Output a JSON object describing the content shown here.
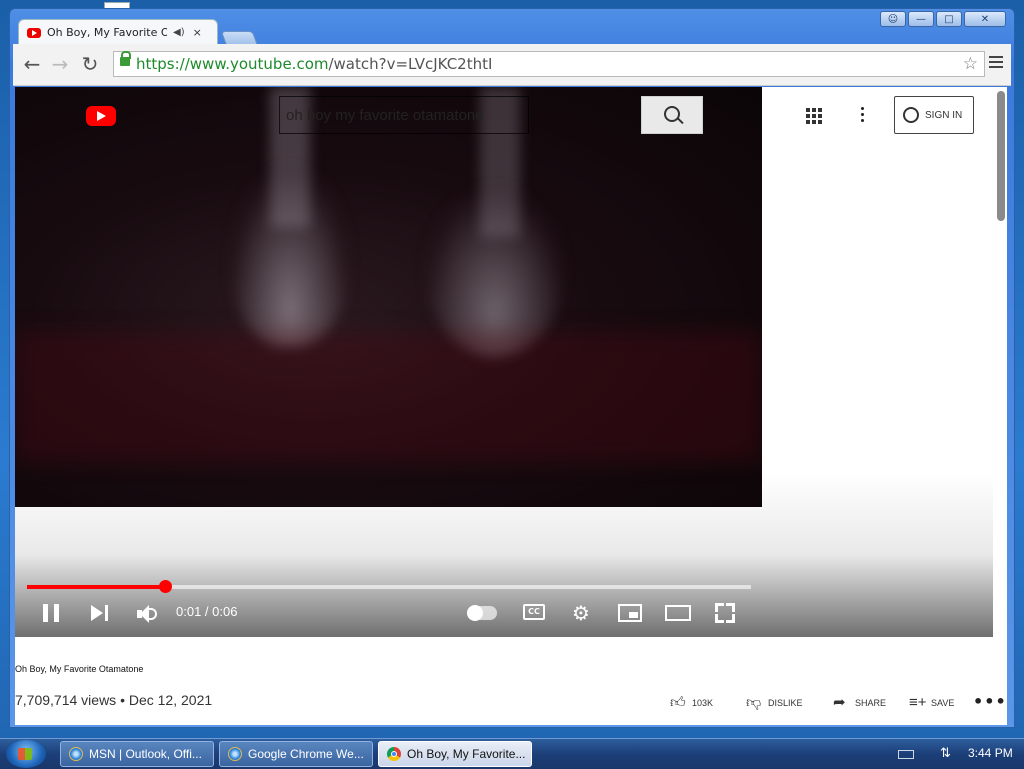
{
  "browser": {
    "tab_title": "Oh Boy, My Favorite Ot",
    "tab_audio_icon": "speaker-icon",
    "tab_close": "×",
    "url_scheme": "https://",
    "url_host": "www.youtube.com",
    "url_path": "/watch?v=LVcJKC2thtI",
    "window_controls": [
      "user-icon",
      "minimize-icon",
      "maximize-icon",
      "close-icon"
    ]
  },
  "youtube": {
    "search_value": "oh boy my favorite otamatone",
    "signin_label": "SIGN IN",
    "video": {
      "time": "0:01 / 0:06",
      "progress_fraction": 0.19,
      "title": "Oh Boy, My Favorite Otamatone",
      "views_line": "7,709,714 views • Dec 12, 2021"
    },
    "actions": {
      "like": "103K",
      "dislike": "DISLIKE",
      "share": "SHARE",
      "save": "SAVE",
      "more": "•••"
    }
  },
  "taskbar": {
    "items": [
      {
        "label": "MSN | Outlook, Offi...",
        "icon": "ie-icon"
      },
      {
        "label": "Google Chrome We...",
        "icon": "ie-icon"
      },
      {
        "label": "Oh Boy, My Favorite...",
        "icon": "chrome-icon"
      }
    ],
    "clock": "3:44 PM"
  },
  "colors": {
    "youtube_red": "#ff0000",
    "url_green": "#1f8a2c",
    "taskbar": "#1c3f78"
  }
}
